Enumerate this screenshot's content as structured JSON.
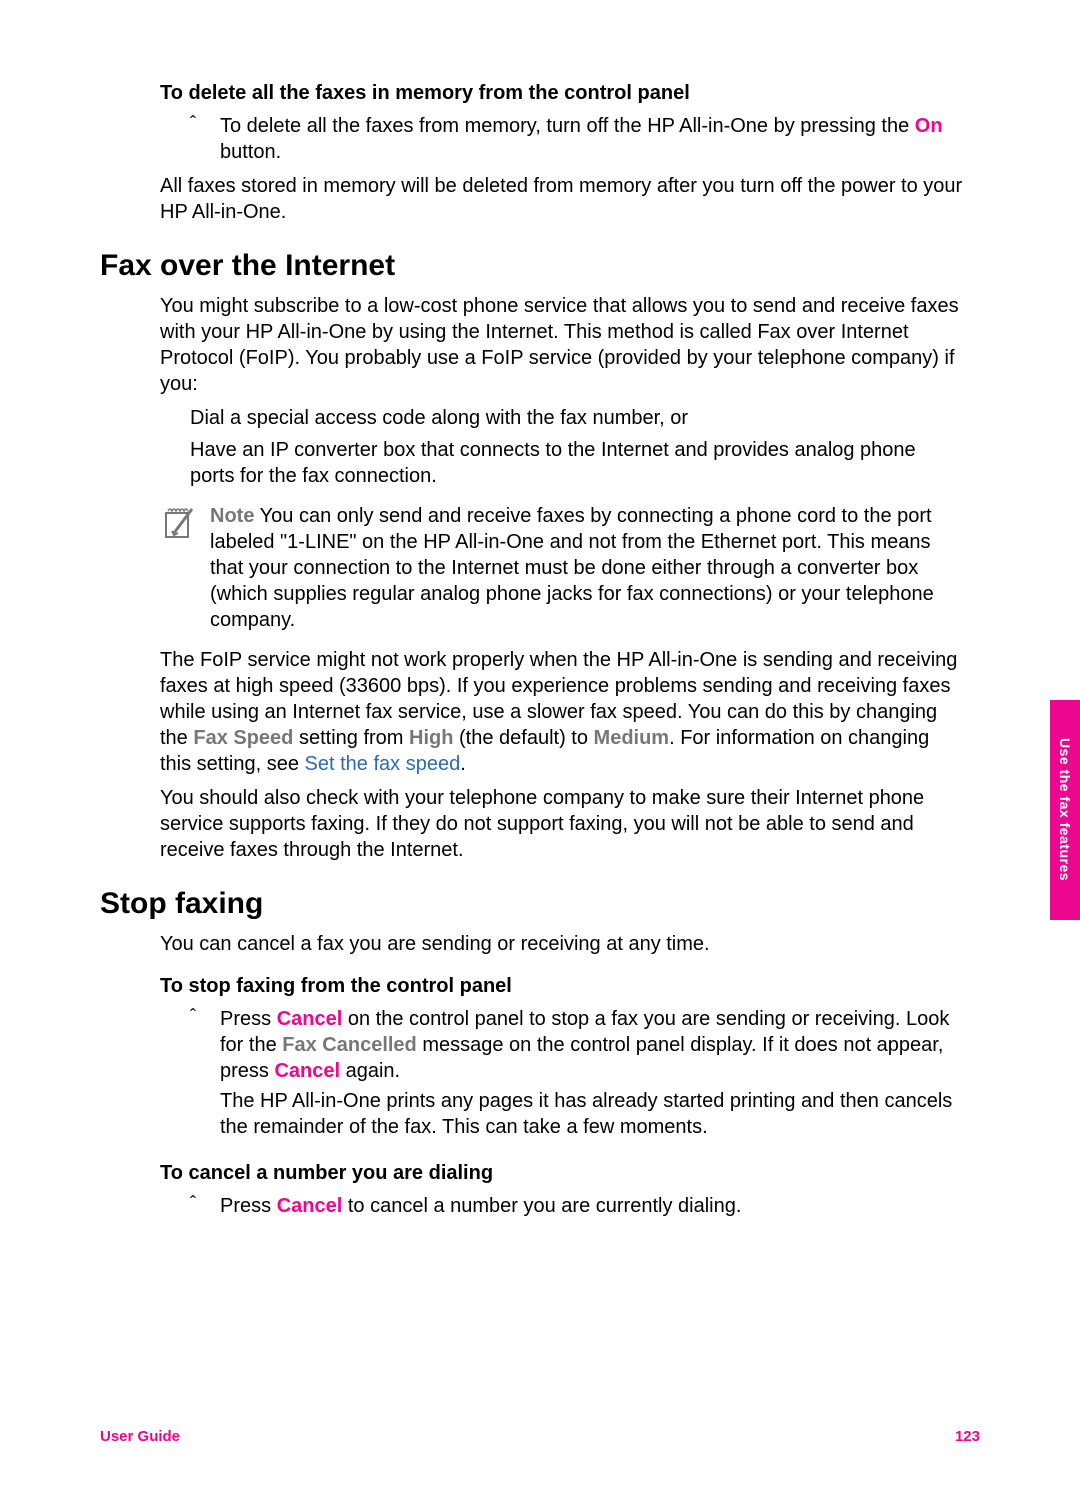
{
  "section1": {
    "heading": "To delete all the faxes in memory from the control panel",
    "step_pre": "To delete all the faxes from memory, turn off the HP All-in-One by pressing the ",
    "step_btn": "On",
    "step_post": " button.",
    "para": "All faxes stored in memory will be deleted from memory after you turn off the power to your HP All-in-One."
  },
  "internet": {
    "heading": "Fax over the Internet",
    "para1": "You might subscribe to a low-cost phone service that allows you to send and receive faxes with your HP All-in-One by using the Internet. This method is called Fax over Internet Protocol (FoIP). You probably use a FoIP service (provided by your telephone company) if you:",
    "bullet1": "Dial a special access code along with the fax number, or",
    "bullet2": "Have an IP converter box that connects to the Internet and provides analog phone ports for the fax connection.",
    "note_label": "Note",
    "note_body": " You can only send and receive faxes by connecting a phone cord to the port labeled \"1-LINE\" on the HP All-in-One and not from the Ethernet port. This means that your connection to the Internet must be done either through a converter box (which supplies regular analog phone jacks for fax connections) or your telephone company.",
    "p2_a": "The FoIP service might not work properly when the HP All-in-One is sending and receiving faxes at high speed (33600 bps). If you experience problems sending and receiving faxes while using an Internet fax service, use a slower fax speed. You can do this by changing the ",
    "p2_fax_speed": "Fax Speed",
    "p2_b": " setting from ",
    "p2_high": "High",
    "p2_c": " (the default) to ",
    "p2_medium": "Medium",
    "p2_d": ". For information on changing this setting, see ",
    "p2_link": "Set the fax speed",
    "p2_e": ".",
    "para3": "You should also check with your telephone company to make sure their Internet phone service supports faxing. If they do not support faxing, you will not be able to send and receive faxes through the Internet."
  },
  "stop": {
    "heading": "Stop faxing",
    "para1": "You can cancel a fax you are sending or receiving at any time.",
    "h3a": "To stop faxing from the control panel",
    "s1_a": "Press ",
    "s1_cancel": "Cancel",
    "s1_b": " on the control panel to stop a fax you are sending or receiving. Look for the ",
    "s1_fax_cancelled": "Fax Cancelled",
    "s1_c": " message on the control panel display. If it does not appear, press ",
    "s1_cancel2": "Cancel",
    "s1_d": " again.",
    "s1_e": "The HP All-in-One prints any pages it has already started printing and then cancels the remainder of the fax. This can take a few moments.",
    "h3b": "To cancel a number you are dialing",
    "s2_a": "Press ",
    "s2_cancel": "Cancel",
    "s2_b": " to cancel a number you are currently dialing."
  },
  "sidebar": "Use the fax features",
  "footer": {
    "left": "User Guide",
    "right": "123"
  }
}
